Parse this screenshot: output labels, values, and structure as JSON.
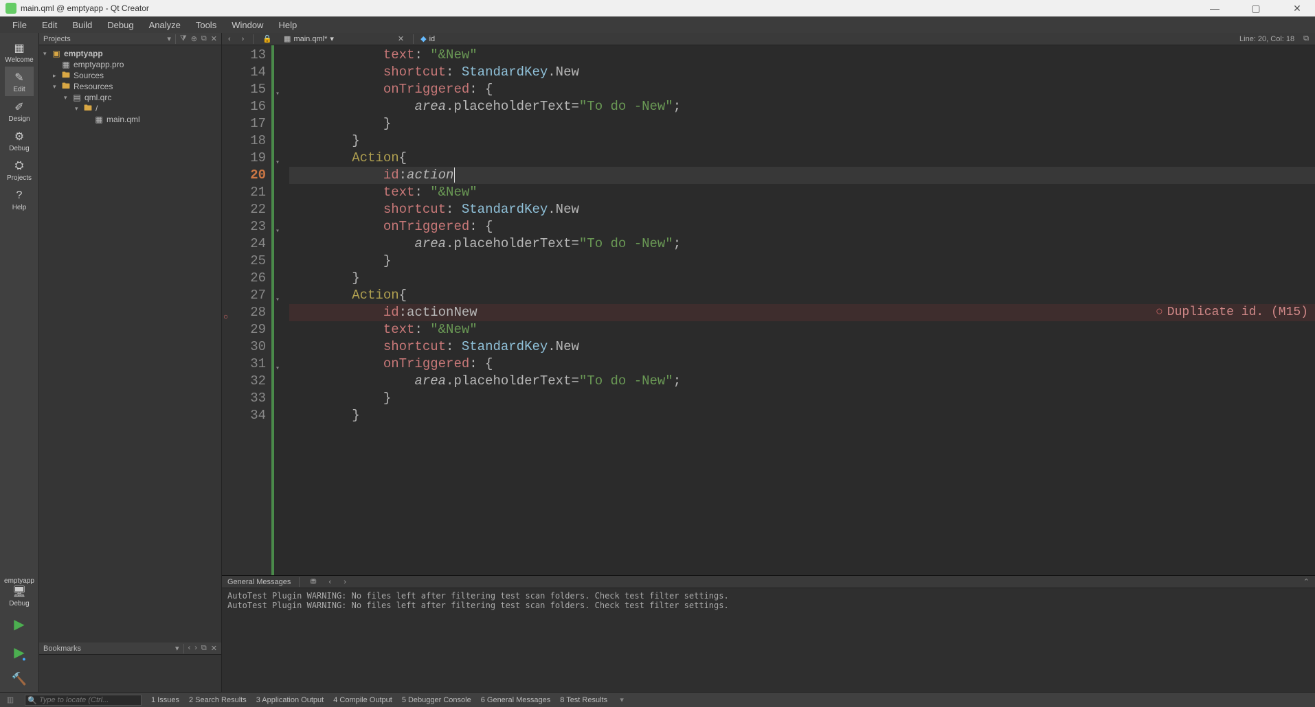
{
  "window": {
    "title": "main.qml @ emptyapp - Qt Creator"
  },
  "menu": [
    "File",
    "Edit",
    "Build",
    "Debug",
    "Analyze",
    "Tools",
    "Window",
    "Help"
  ],
  "modes": [
    {
      "label": "Welcome",
      "icon": "▦"
    },
    {
      "label": "Edit",
      "icon": "✎",
      "active": true
    },
    {
      "label": "Design",
      "icon": "✐"
    },
    {
      "label": "Debug",
      "icon": "⚙"
    },
    {
      "label": "Projects",
      "icon": "⛭"
    },
    {
      "label": "Help",
      "icon": "?"
    }
  ],
  "mode_bottom": {
    "project": "emptyapp",
    "config": "Debug"
  },
  "sidebar": {
    "projects_title": "Projects",
    "bookmarks_title": "Bookmarks",
    "tree": {
      "project": "emptyapp",
      "pro": "emptyapp.pro",
      "sources": "Sources",
      "resources": "Resources",
      "qrc": "qml.qrc",
      "slash": "/",
      "mainqml": "main.qml"
    }
  },
  "editor": {
    "filename": "main.qml*",
    "symbol": "id",
    "cursor": "Line: 20, Col: 18",
    "first_line": 13,
    "current_line": 20,
    "error_line": 28,
    "error_text": "Duplicate id. (M15)",
    "fold_lines": [
      15,
      19,
      23,
      27,
      31
    ],
    "lines": [
      [
        [
          "            ",
          "plain"
        ],
        [
          "text",
          "prop"
        ],
        [
          ": ",
          "punct"
        ],
        [
          "\"&New\"",
          "str"
        ]
      ],
      [
        [
          "            ",
          "plain"
        ],
        [
          "shortcut",
          "prop"
        ],
        [
          ": ",
          "punct"
        ],
        [
          "StandardKey",
          "ident"
        ],
        [
          ".New",
          "plain"
        ]
      ],
      [
        [
          "            ",
          "plain"
        ],
        [
          "onTriggered",
          "prop"
        ],
        [
          ": {",
          "punct"
        ]
      ],
      [
        [
          "                ",
          "plain"
        ],
        [
          "area",
          "id"
        ],
        [
          ".placeholderText=",
          "plain"
        ],
        [
          "\"To do -New\"",
          "str"
        ],
        [
          ";",
          "punct"
        ]
      ],
      [
        [
          "            }",
          "punct"
        ]
      ],
      [
        [
          "        }",
          "punct"
        ]
      ],
      [
        [
          "        ",
          "plain"
        ],
        [
          "Action",
          "type"
        ],
        [
          "{",
          "punct"
        ]
      ],
      [
        [
          "            ",
          "plain"
        ],
        [
          "id",
          "prop"
        ],
        [
          ":",
          "punct"
        ],
        [
          "action",
          "id"
        ]
      ],
      [
        [
          "            ",
          "plain"
        ],
        [
          "text",
          "prop"
        ],
        [
          ": ",
          "punct"
        ],
        [
          "\"&New\"",
          "str"
        ]
      ],
      [
        [
          "            ",
          "plain"
        ],
        [
          "shortcut",
          "prop"
        ],
        [
          ": ",
          "punct"
        ],
        [
          "StandardKey",
          "ident"
        ],
        [
          ".New",
          "plain"
        ]
      ],
      [
        [
          "            ",
          "plain"
        ],
        [
          "onTriggered",
          "prop"
        ],
        [
          ": {",
          "punct"
        ]
      ],
      [
        [
          "                ",
          "plain"
        ],
        [
          "area",
          "id"
        ],
        [
          ".placeholderText=",
          "plain"
        ],
        [
          "\"To do -New\"",
          "str"
        ],
        [
          ";",
          "punct"
        ]
      ],
      [
        [
          "            }",
          "punct"
        ]
      ],
      [
        [
          "        }",
          "punct"
        ]
      ],
      [
        [
          "        ",
          "plain"
        ],
        [
          "Action",
          "type"
        ],
        [
          "{",
          "punct"
        ]
      ],
      [
        [
          "            ",
          "plain"
        ],
        [
          "id",
          "prop"
        ],
        [
          ":",
          "punct"
        ],
        [
          "actionNew",
          "plain"
        ]
      ],
      [
        [
          "            ",
          "plain"
        ],
        [
          "text",
          "prop"
        ],
        [
          ": ",
          "punct"
        ],
        [
          "\"&New\"",
          "str"
        ]
      ],
      [
        [
          "            ",
          "plain"
        ],
        [
          "shortcut",
          "prop"
        ],
        [
          ": ",
          "punct"
        ],
        [
          "StandardKey",
          "ident"
        ],
        [
          ".New",
          "plain"
        ]
      ],
      [
        [
          "            ",
          "plain"
        ],
        [
          "onTriggered",
          "prop"
        ],
        [
          ": {",
          "punct"
        ]
      ],
      [
        [
          "                ",
          "plain"
        ],
        [
          "area",
          "id"
        ],
        [
          ".placeholderText=",
          "plain"
        ],
        [
          "\"To do -New\"",
          "str"
        ],
        [
          ";",
          "punct"
        ]
      ],
      [
        [
          "            }",
          "punct"
        ]
      ],
      [
        [
          "        }",
          "punct"
        ]
      ]
    ]
  },
  "messages": {
    "title": "General Messages",
    "lines": [
      "AutoTest Plugin WARNING: No files left after filtering test scan folders. Check test filter settings.",
      "AutoTest Plugin WARNING: No files left after filtering test scan folders. Check test filter settings."
    ]
  },
  "status": {
    "locate_placeholder": "Type to locate (Ctrl...",
    "panes": [
      "1 Issues",
      "2 Search Results",
      "3 Application Output",
      "4 Compile Output",
      "5 Debugger Console",
      "6 General Messages",
      "8 Test Results"
    ]
  }
}
